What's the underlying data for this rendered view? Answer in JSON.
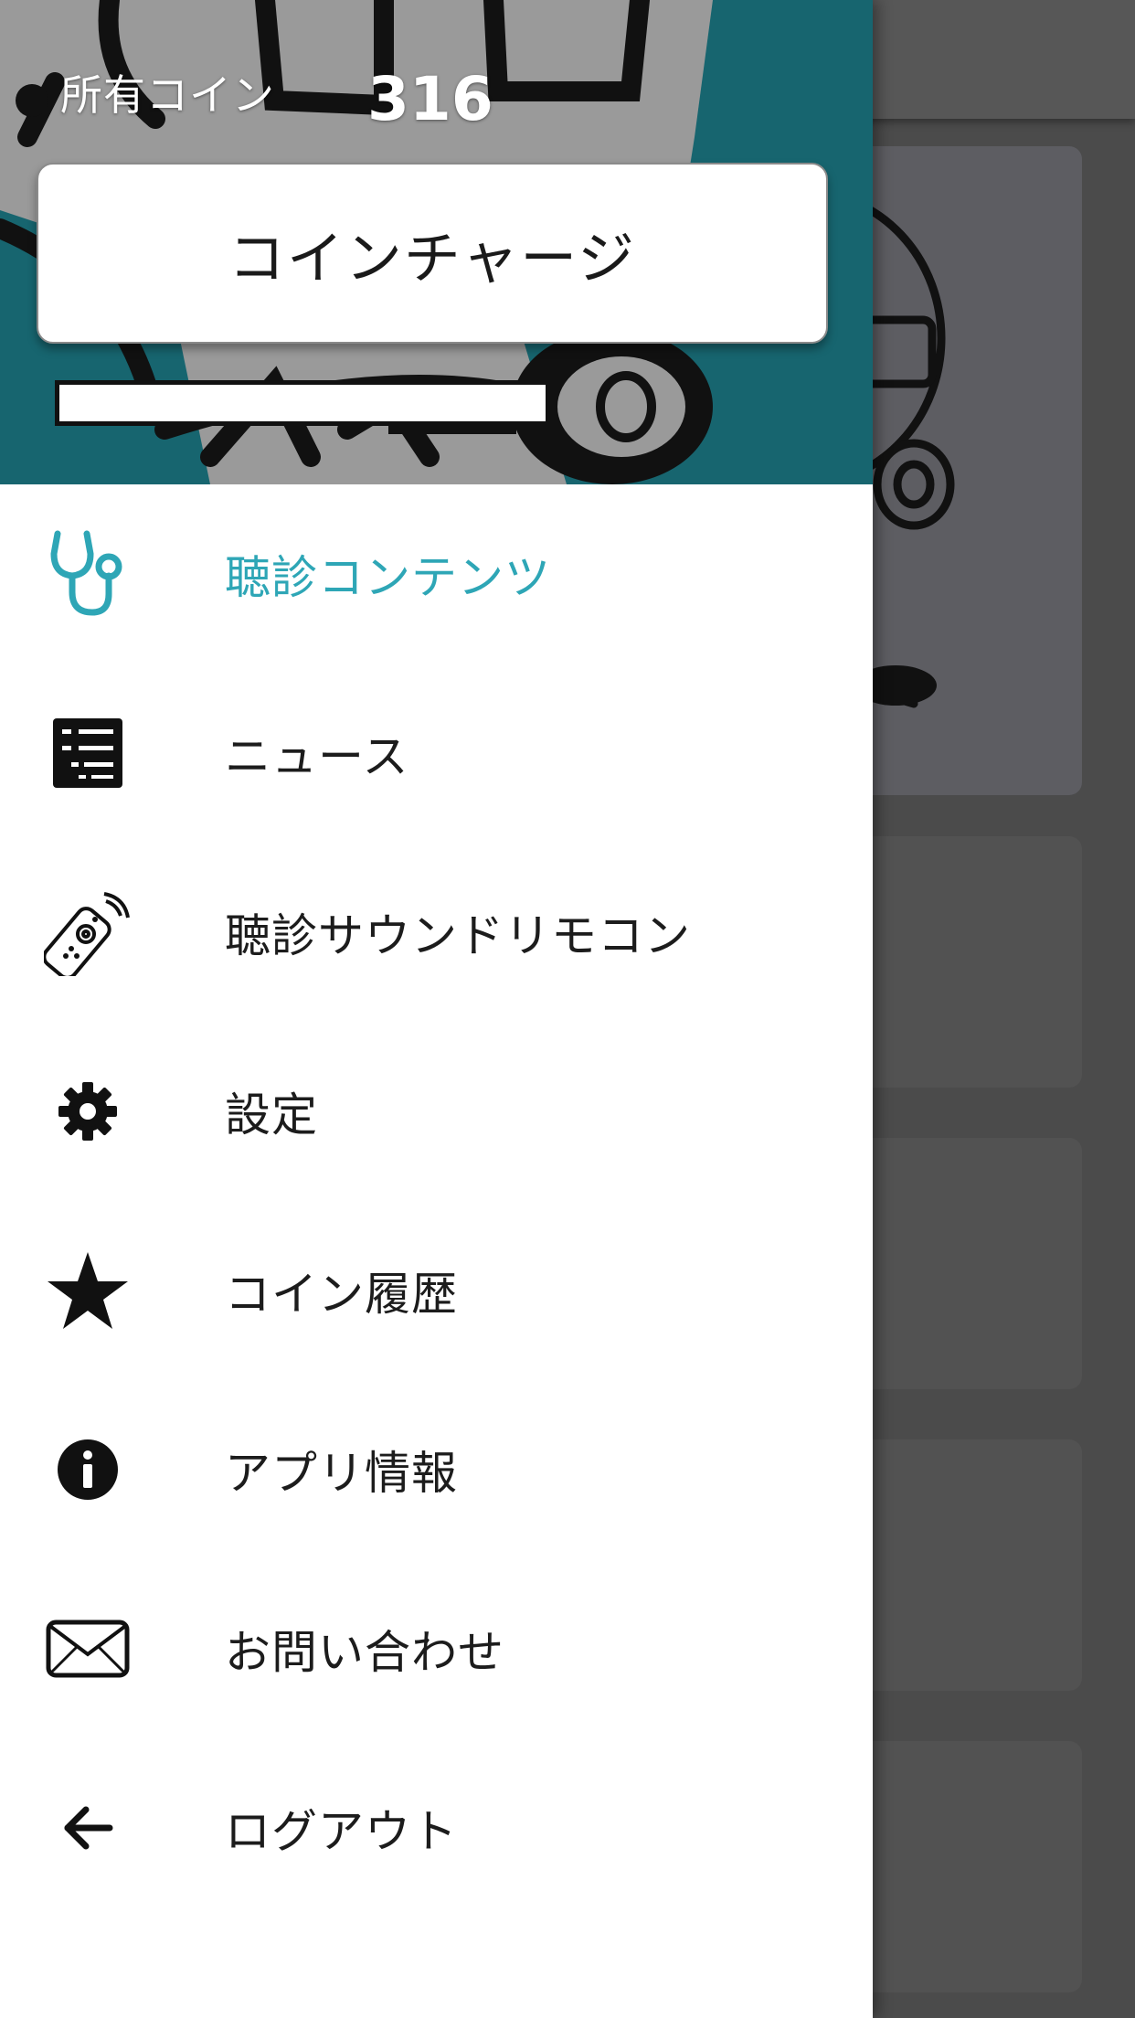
{
  "drawer": {
    "coin_label": "所有コイン",
    "coin_count": "316",
    "charge_button": "コインチャージ",
    "menu": [
      {
        "label": "聴診コンテンツ",
        "icon": "stethoscope-icon",
        "active": true
      },
      {
        "label": "ニュース",
        "icon": "news-list-icon"
      },
      {
        "label": "聴診サウンドリモコン",
        "icon": "remote-control-icon"
      },
      {
        "label": "設定",
        "icon": "gear-icon"
      },
      {
        "label": "コイン履歴",
        "icon": "star-icon"
      },
      {
        "label": "アプリ情報",
        "icon": "info-icon"
      },
      {
        "label": "お問い合わせ",
        "icon": "mail-icon"
      },
      {
        "label": "ログアウト",
        "icon": "arrow-left-icon"
      }
    ]
  },
  "colors": {
    "accent": "#2ea6b6",
    "header_teal": "#17656f",
    "scrim": "#4b4b4b"
  }
}
